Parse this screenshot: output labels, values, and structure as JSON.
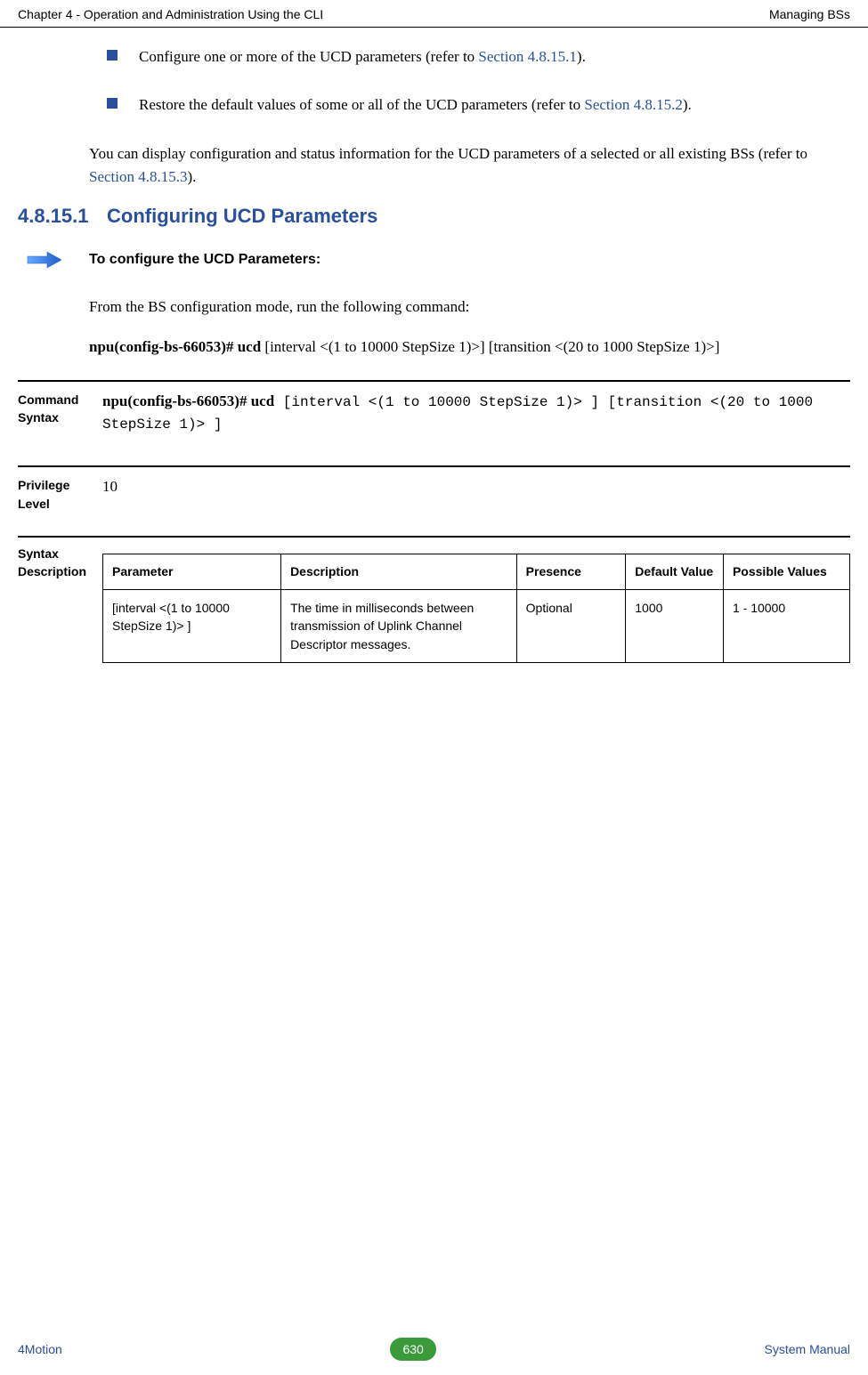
{
  "header": {
    "left": "Chapter 4 - Operation and Administration Using the CLI",
    "right": "Managing BSs"
  },
  "bullets": [
    {
      "pre": "Configure one or more of the UCD parameters (refer to ",
      "link": "Section 4.8.15.1",
      "post": ")."
    },
    {
      "pre": "Restore the default values of some or all of the UCD parameters (refer to ",
      "link": "Section 4.8.15.2",
      "post": ")."
    }
  ],
  "intro": {
    "pre": "You can display configuration and status information for the UCD parameters of a selected or all existing BSs (refer to ",
    "link": "Section 4.8.15.3",
    "post": ")."
  },
  "section": {
    "number": "4.8.15.1",
    "title": "Configuring UCD Parameters"
  },
  "arrow_label": "To configure the UCD Parameters:",
  "cmd_intro": "From the BS configuration mode, run the following command:",
  "cmd_line": {
    "bold": "npu(config-bs-66053)# ucd",
    "rest": " [interval <(1 to 10000 StepSize 1)>] [transition <(20 to 1000 StepSize 1)>]"
  },
  "command_syntax": {
    "label": "Command Syntax",
    "bold": "npu(config-bs-66053)# ucd",
    "mono": " [interval <(1 to 10000 StepSize 1)> ] [transition <(20 to 1000 StepSize 1)> ]"
  },
  "privilege": {
    "label": "Privilege Level",
    "value": "10"
  },
  "syntax_desc": {
    "label": "Syntax Description",
    "headers": {
      "param": "Parameter",
      "desc": "Description",
      "pres": "Presence",
      "def": "Default Value",
      "poss": "Possible Values"
    },
    "rows": [
      {
        "param": "[interval <(1 to 10000 StepSize 1)> ]",
        "desc": "The time in milliseconds between transmission of Uplink Channel Descriptor messages.",
        "pres": "Optional",
        "def": "1000",
        "poss": "1 - 10000"
      }
    ]
  },
  "footer": {
    "left": "4Motion",
    "page": "630",
    "right": "System Manual"
  }
}
